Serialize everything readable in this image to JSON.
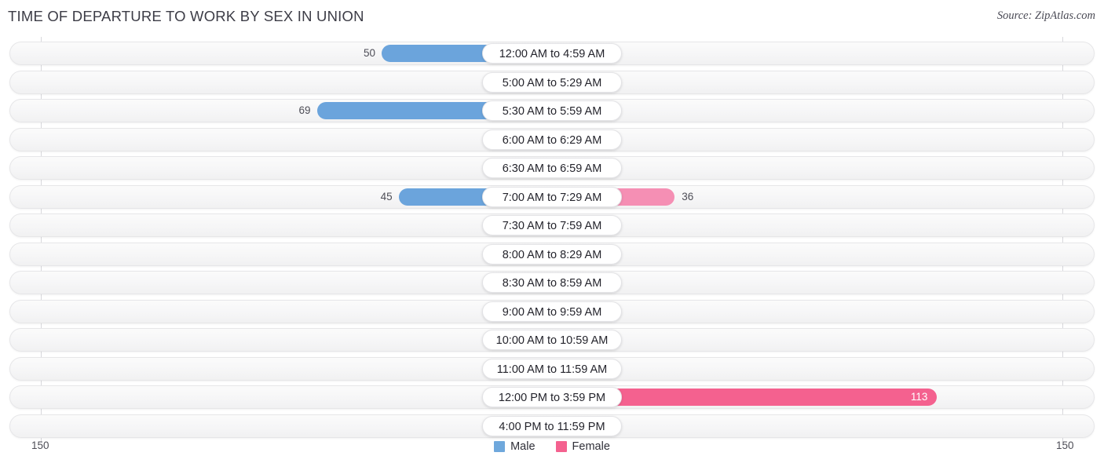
{
  "header": {
    "title": "TIME OF DEPARTURE TO WORK BY SEX IN UNION",
    "source": "Source: ZipAtlas.com"
  },
  "legend": {
    "items": [
      {
        "label": "Male",
        "color": "#6fa8dc"
      },
      {
        "label": "Female",
        "color": "#f4618f"
      }
    ]
  },
  "axis": {
    "left_label": "150",
    "right_label": "150",
    "max": 150
  },
  "colors": {
    "male_strong": "#6ba4dc",
    "male_zero": "#aecbef",
    "female_strong": "#f4618f",
    "female_mid": "#f58fb4",
    "female_zero": "#f7a8c4",
    "track": "#f4f4f5",
    "gridline": "#d8d8dc",
    "text": "#4e4e57"
  },
  "chart_data": {
    "type": "bar",
    "orientation": "horizontal-diverging",
    "title": "TIME OF DEPARTURE TO WORK BY SEX IN UNION",
    "xlabel": "",
    "ylabel": "",
    "xlim": [
      -150,
      150
    ],
    "axis_max": 150,
    "grid": true,
    "legend_position": "bottom-center",
    "categories": [
      "12:00 AM to 4:59 AM",
      "5:00 AM to 5:29 AM",
      "5:30 AM to 5:59 AM",
      "6:00 AM to 6:29 AM",
      "6:30 AM to 6:59 AM",
      "7:00 AM to 7:29 AM",
      "7:30 AM to 7:59 AM",
      "8:00 AM to 8:29 AM",
      "8:30 AM to 8:59 AM",
      "9:00 AM to 9:59 AM",
      "10:00 AM to 10:59 AM",
      "11:00 AM to 11:59 AM",
      "12:00 PM to 3:59 PM",
      "4:00 PM to 11:59 PM"
    ],
    "series": [
      {
        "name": "Male",
        "values": [
          50,
          0,
          69,
          0,
          0,
          45,
          0,
          0,
          0,
          0,
          0,
          0,
          0,
          0
        ]
      },
      {
        "name": "Female",
        "values": [
          0,
          0,
          0,
          0,
          0,
          36,
          0,
          0,
          0,
          0,
          0,
          0,
          113,
          0
        ]
      }
    ]
  },
  "rows": [
    {
      "label": "12:00 AM to 4:59 AM",
      "male": "50",
      "female": "0"
    },
    {
      "label": "5:00 AM to 5:29 AM",
      "male": "0",
      "female": "0"
    },
    {
      "label": "5:30 AM to 5:59 AM",
      "male": "69",
      "female": "0"
    },
    {
      "label": "6:00 AM to 6:29 AM",
      "male": "0",
      "female": "0"
    },
    {
      "label": "6:30 AM to 6:59 AM",
      "male": "0",
      "female": "0"
    },
    {
      "label": "7:00 AM to 7:29 AM",
      "male": "45",
      "female": "36"
    },
    {
      "label": "7:30 AM to 7:59 AM",
      "male": "0",
      "female": "0"
    },
    {
      "label": "8:00 AM to 8:29 AM",
      "male": "0",
      "female": "0"
    },
    {
      "label": "8:30 AM to 8:59 AM",
      "male": "0",
      "female": "0"
    },
    {
      "label": "9:00 AM to 9:59 AM",
      "male": "0",
      "female": "0"
    },
    {
      "label": "10:00 AM to 10:59 AM",
      "male": "0",
      "female": "0"
    },
    {
      "label": "11:00 AM to 11:59 AM",
      "male": "0",
      "female": "0"
    },
    {
      "label": "12:00 PM to 3:59 PM",
      "male": "0",
      "female": "113"
    },
    {
      "label": "4:00 PM to 11:59 PM",
      "male": "0",
      "female": "0"
    }
  ]
}
